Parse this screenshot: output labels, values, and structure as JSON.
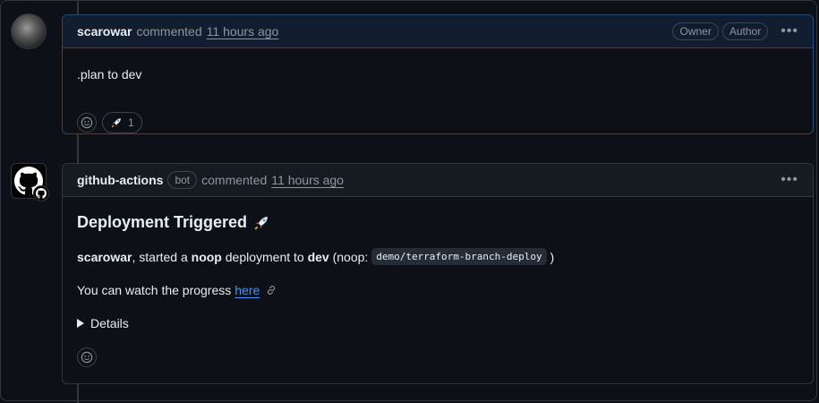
{
  "comments": [
    {
      "author": "scarowar",
      "verb": "commented",
      "time": "11 hours ago",
      "badges": [
        "Owner",
        "Author"
      ],
      "body": ".plan to dev",
      "reaction": {
        "icon": "rocket-icon",
        "count": "1"
      }
    },
    {
      "author": "github-actions",
      "bot_label": "bot",
      "verb": "commented",
      "time": "11 hours ago",
      "title": "Deployment Triggered",
      "line1": {
        "user": "scarowar",
        "t1": ", started a ",
        "mode": "noop",
        "t2": " deployment to ",
        "env": "dev",
        "t3": " (noop: ",
        "code": "demo/terraform-branch-deploy",
        "t4": " )"
      },
      "line2": {
        "text": "You can watch the progress",
        "link": "here"
      },
      "details": "Details"
    }
  ],
  "colors": {
    "link": "#4493f8",
    "border_owned": "#1f4a7a"
  }
}
